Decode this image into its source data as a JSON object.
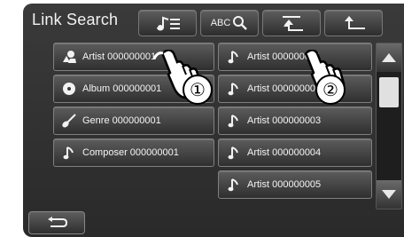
{
  "title": "Link Search",
  "toolbar": {
    "music_list_icon": "music-list-icon",
    "abc_search_text": "ABC",
    "search_icon": "magnifier-icon",
    "up_level_icon": "up-level-icon",
    "return_icon": "return-icon"
  },
  "left_list": [
    {
      "label": "Artist 000000001",
      "icon": "artist-icon"
    },
    {
      "label": "Album 000000001",
      "icon": "album-disc-icon"
    },
    {
      "label": "Genre 000000001",
      "icon": "guitar-icon"
    },
    {
      "label": "Composer 000000001",
      "icon": "music-note-icon"
    }
  ],
  "right_list": [
    {
      "label": "Artist 000000001",
      "icon": "music-note-icon"
    },
    {
      "label": "Artist 000000002",
      "icon": "music-note-icon"
    },
    {
      "label": "Artist 000000003",
      "icon": "music-note-icon"
    },
    {
      "label": "Artist 000000004",
      "icon": "music-note-icon"
    },
    {
      "label": "Artist 000000005",
      "icon": "music-note-icon"
    }
  ],
  "callouts": [
    "①",
    "②"
  ],
  "back_icon": "back-arrow-icon"
}
